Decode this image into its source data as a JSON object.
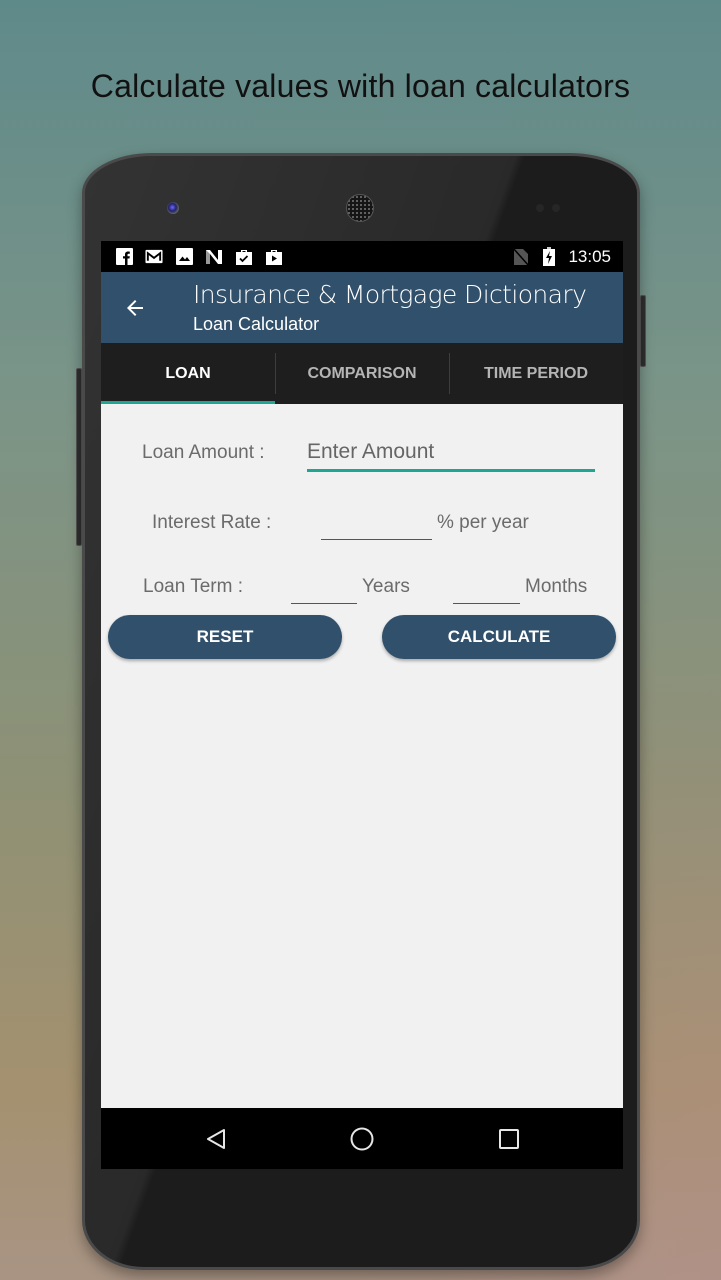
{
  "headline": "Calculate values with loan calculators",
  "status_bar": {
    "left_icons": [
      "facebook-icon",
      "gmail-icon",
      "image-icon",
      "n-app-icon",
      "briefcase-check-icon",
      "play-store-icon"
    ],
    "right_icons": [
      "no-sim-icon",
      "battery-charging-icon"
    ],
    "time": "13:05"
  },
  "app_bar": {
    "back_icon": "arrow-left-icon",
    "title": "Insurance & Mortgage Dictionary",
    "subtitle": "Loan Calculator"
  },
  "tabs": [
    {
      "label": "LOAN",
      "active": true
    },
    {
      "label": "COMPARISON",
      "active": false
    },
    {
      "label": "TIME PERIOD",
      "active": false
    }
  ],
  "form": {
    "loan_amount_label": "Loan Amount :",
    "loan_amount_value": "",
    "loan_amount_placeholder": "Enter Amount",
    "interest_rate_label": "Interest Rate :",
    "interest_rate_value": "",
    "interest_rate_suffix": "% per year",
    "loan_term_label": "Loan Term :",
    "years_value": "",
    "years_label": "Years",
    "months_value": "",
    "months_label": "Months"
  },
  "buttons": {
    "reset": "RESET",
    "calculate": "CALCULATE"
  },
  "nav_bar": {
    "back": "triangle-back-icon",
    "home": "circle-home-icon",
    "recents": "square-recents-icon"
  },
  "colors": {
    "primary": "#30506b",
    "accent": "#1fa692",
    "tab_bar": "#1e1e1e"
  }
}
